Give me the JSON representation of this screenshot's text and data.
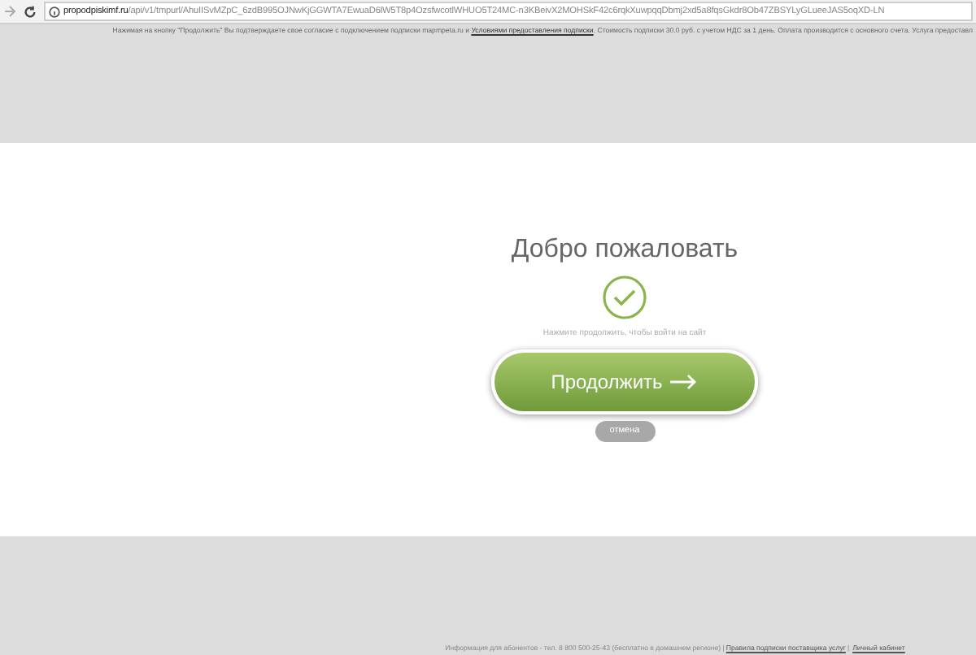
{
  "browser": {
    "url_host": "propodpiskimf.ru",
    "url_path": "/api/v1/tmpurl/AhuIISvMZpC_6zdB995OJNwKjGGWTA7EwuaD6lW5T8p4OzsfwcotlWHUO5T24MC-n3KBeivX2MOHSkF42c6rqkXuwpqqDbmj2xd5a8fqsGkdr8Ob47ZBSYLyGLueeJAS5oqXD-LN"
  },
  "notice": {
    "before": "Нажимая на кнопку \"Продолжить\" Вы подтверждаете свое согласие с подключением подписки mapmpeta.ru и",
    "link": "Условиями предоставления подписки",
    "after": ". Стоимость подписки 30.0 руб. с учетом НДС за 1 день. Оплата производится с основного счета. Услуга предоставл"
  },
  "card": {
    "title": "Добро пожаловать",
    "hint": "Нажмите продолжить, чтобы войти на сайт",
    "continue_button": "Продолжить",
    "cancel_button": "отмена"
  },
  "footer": {
    "info": "Информация для абонентов - тел. 8 800 500-25-43 (бесплатно в домашнем регионе) |",
    "separator": "|",
    "links": [
      {
        "label": "Правила подписки поставщика услуг"
      },
      {
        "label": "Личный кабинет"
      }
    ]
  }
}
